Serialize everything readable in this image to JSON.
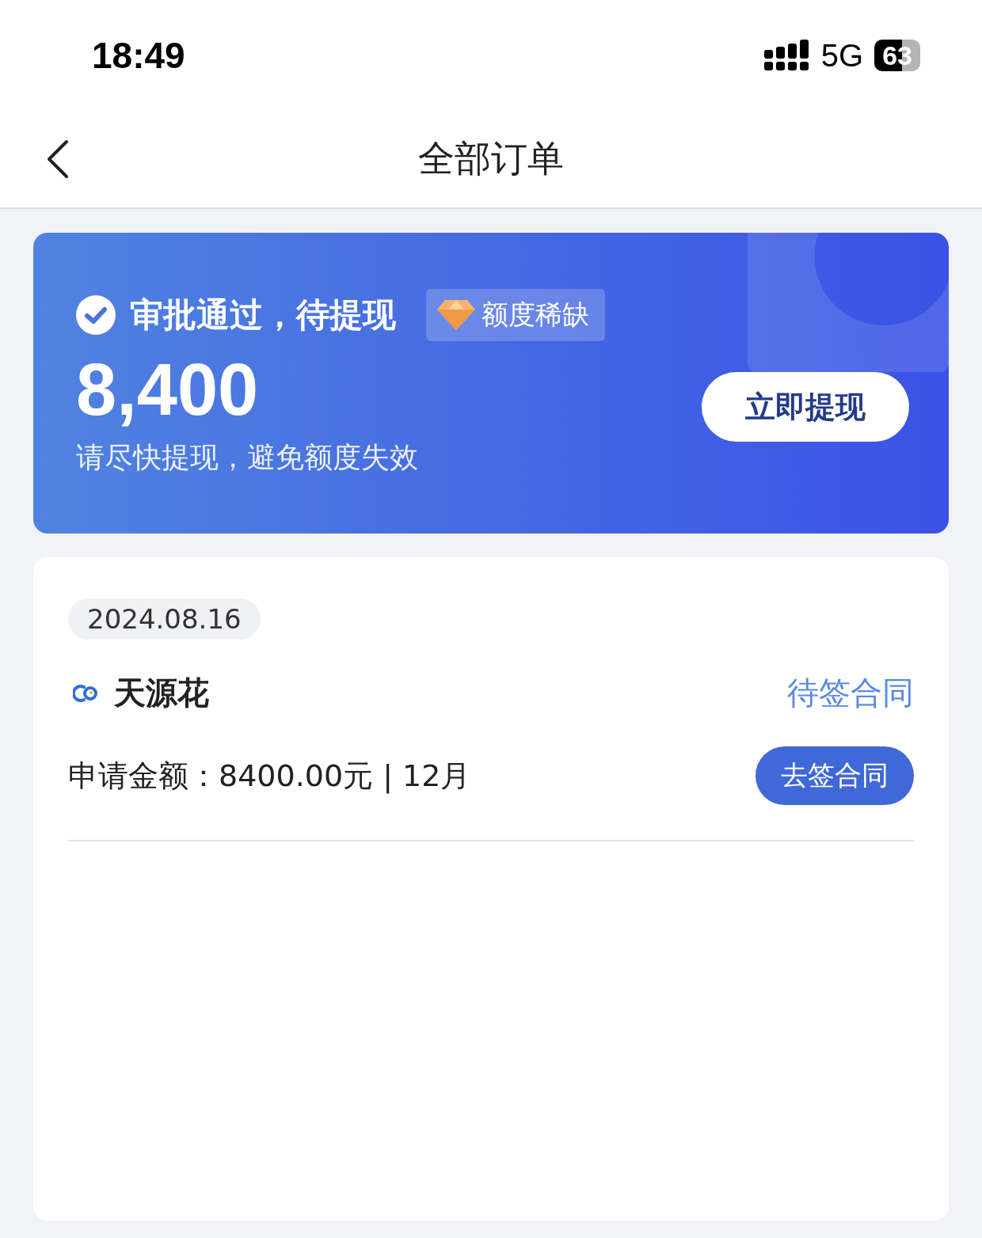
{
  "status_bar": {
    "time": "18:49",
    "network": "5G",
    "battery": "63"
  },
  "header": {
    "title": "全部订单"
  },
  "banner": {
    "status": "审批通过，待提现",
    "tag": "额度稀缺",
    "amount": "8,400",
    "hint": "请尽快提现，避免额度失效",
    "button": "立即提现"
  },
  "orders": [
    {
      "date": "2024.08.16",
      "product": "天源花",
      "status": "待签合同",
      "summary": "申请金额：8400.00元 | 12月",
      "button": "去签合同"
    }
  ]
}
